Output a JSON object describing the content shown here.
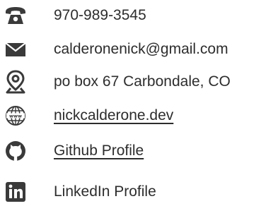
{
  "contact": {
    "phone": {
      "icon": "phone-icon",
      "text": "970-989-3545"
    },
    "email": {
      "icon": "envelope-icon",
      "text": "calderonenick@gmail.com"
    },
    "address": {
      "icon": "map-pin-icon",
      "text": "po box 67 Carbondale, CO"
    },
    "website": {
      "icon": "globe-www-icon",
      "text": "nickcalderone.dev"
    },
    "github": {
      "icon": "github-icon",
      "text": "Github Profile"
    },
    "linkedin": {
      "icon": "linkedin-icon",
      "text": "LinkedIn Profile"
    }
  },
  "colors": {
    "icon": "#3a3a3a",
    "text": "#2d2d2d"
  }
}
